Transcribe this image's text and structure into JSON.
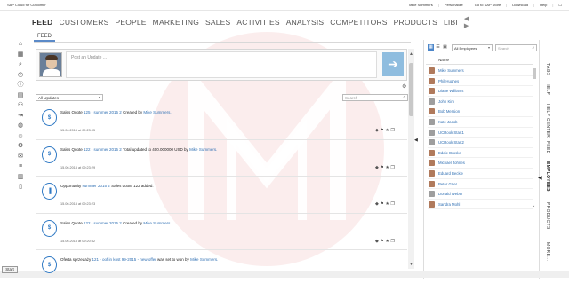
{
  "app": {
    "title": "SAP Cloud for Customer"
  },
  "topbar": {
    "links": [
      {
        "label": "Mike Summers"
      },
      {
        "label": "Personalize"
      },
      {
        "label": "Go to SAP Store"
      },
      {
        "label": "Download"
      },
      {
        "label": "Help"
      }
    ]
  },
  "nav": {
    "items": [
      {
        "label": "FEED"
      },
      {
        "label": "CUSTOMERS"
      },
      {
        "label": "PEOPLE"
      },
      {
        "label": "MARKETING"
      },
      {
        "label": "SALES"
      },
      {
        "label": "ACTIVITIES"
      },
      {
        "label": "ANALYSIS"
      },
      {
        "label": "COMPETITORS"
      },
      {
        "label": "PRODUCTS"
      },
      {
        "label": "LIBI"
      }
    ],
    "more_arrows": "◀ ▶"
  },
  "left_rail": {
    "icons": [
      "home-icon",
      "calendar-icon",
      "search-icon",
      "clock-icon",
      "info-icon",
      "calendar-list-icon",
      "people-icon",
      "login-icon",
      "globe-icon",
      "person-icon",
      "settings-icon",
      "chat-icon",
      "list-icon",
      "report-icon",
      "document-icon"
    ]
  },
  "feed": {
    "tab_label": "FEED",
    "update_placeholder": "Post an Update ...",
    "filter": {
      "selected": "All Updates"
    },
    "search": {
      "placeholder": "Search"
    },
    "items": [
      {
        "icon": "$",
        "text_before": "Sales Quote",
        "link": "125 - summer 2015 2",
        "text_after": "Created by",
        "author": "Mike Summers.",
        "date": "15.06.2015 at 09:23:05"
      },
      {
        "icon": "$",
        "text_before": "Sales Quote",
        "link": "122 - summer 2015 2",
        "text_after": "Total updated to 400.000000 USD by",
        "author": "Mike Summers.",
        "date": "15.06.2015 at 09:23:29"
      },
      {
        "icon": "▐",
        "text_before": "Opportunity",
        "link": "summer 2015 2",
        "text_after": "Sales quote 122 added.",
        "author": "",
        "date": "15.06.2015 at 09:23:23"
      },
      {
        "icon": "$",
        "text_before": "Sales Quote",
        "link": "122 - summer 2015 2",
        "text_after": "Created by",
        "author": "Mike Summers.",
        "date": "15.06.2015 at 09:20:52"
      },
      {
        "icon": "$",
        "text_before": "Oferta sprzedaży",
        "link": "121 - oof in kost 99-2015 - new offer",
        "text_after": "was set to won by",
        "author": "Mike Summers.",
        "date": ""
      }
    ]
  },
  "employees": {
    "filter": {
      "selected": "All Employees"
    },
    "search": {
      "placeholder": "Search"
    },
    "header": "Name",
    "list": [
      {
        "name": "Mike Summers"
      },
      {
        "name": "Phil Hughes"
      },
      {
        "name": "Diane Williams"
      },
      {
        "name": "John Kim"
      },
      {
        "name": "Bob Mersion"
      },
      {
        "name": "Kate Jacob"
      },
      {
        "name": "UCRook Start1"
      },
      {
        "name": "UCRook Start2"
      },
      {
        "name": "Eddie Droske"
      },
      {
        "name": "Michael Johnes"
      },
      {
        "name": "Eduard Beckie"
      },
      {
        "name": "Peter Grier"
      },
      {
        "name": "Donald Weber"
      },
      {
        "name": "Sandra Mohl"
      }
    ]
  },
  "side_tabs": [
    {
      "label": "TAGS"
    },
    {
      "label": "HELP"
    },
    {
      "label": "HELP CENTER"
    },
    {
      "label": "FEED"
    },
    {
      "label": "EMPLOYEES"
    },
    {
      "label": "PRODUCTS"
    },
    {
      "label": "MORE..."
    }
  ],
  "start_button": "Start"
}
